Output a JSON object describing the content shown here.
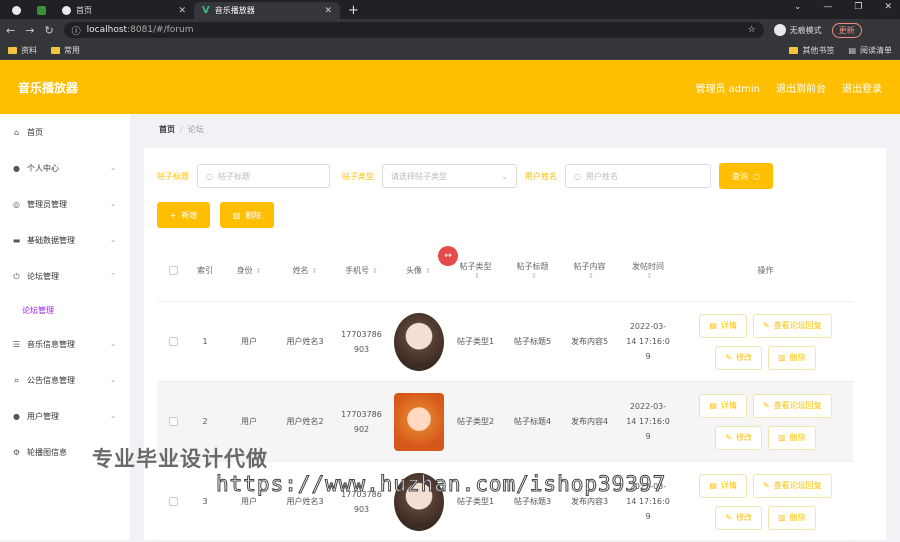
{
  "browser": {
    "tabs": [
      {
        "label": ""
      },
      {
        "label": ""
      },
      {
        "label": "首页"
      },
      {
        "label": "音乐播放器"
      }
    ],
    "url_host": "localhost",
    "url_path": ":8081/#/forum",
    "incognito_label": "无痕模式",
    "update_label": "更新",
    "bookmarks": [
      "资料",
      "常用"
    ],
    "bookmarks_right": [
      "其他书签",
      "阅读清单"
    ]
  },
  "header": {
    "brand": "音乐播放器",
    "admin": "管理员 admin",
    "back_to_front": "退出到前台",
    "logout": "退出登录"
  },
  "sidebar": {
    "items": [
      {
        "label": "首页",
        "icon": "home-icon"
      },
      {
        "label": "个人中心",
        "icon": "user-icon"
      },
      {
        "label": "管理员管理",
        "icon": "compass-icon"
      },
      {
        "label": "基础数据管理",
        "icon": "database-icon"
      },
      {
        "label": "论坛管理",
        "icon": "power-icon"
      },
      {
        "label": "音乐信息管理",
        "icon": "menu-icon"
      },
      {
        "label": "公告信息管理",
        "icon": "crop-icon"
      },
      {
        "label": "用户管理",
        "icon": "user-icon"
      },
      {
        "label": "轮播图信息",
        "icon": "settings-icon"
      }
    ],
    "subitem": "论坛管理"
  },
  "breadcrumb": {
    "home": "首页",
    "sep": "/",
    "current": "论坛"
  },
  "search": {
    "title_label": "帖子标题",
    "title_placeholder": "帖子标题",
    "type_label": "帖子类型",
    "type_placeholder": "请选择帖子类型",
    "user_label": "用户姓名",
    "user_placeholder": "用户姓名",
    "query_button": "查询"
  },
  "actions": {
    "add": "新增",
    "delete": "删除"
  },
  "table": {
    "headers": [
      "索引",
      "身份",
      "姓名",
      "手机号",
      "头像",
      "帖子类型",
      "帖子标题",
      "帖子内容",
      "发帖时间",
      "操作"
    ],
    "rows": [
      {
        "index": "1",
        "role": "用户",
        "name": "用户姓名3",
        "phone1": "17703786",
        "phone2": "903",
        "type": "帖子类型1",
        "title": "帖子标题5",
        "content": "发布内容5",
        "time1": "2022-03-",
        "time2": "14 17:16:0",
        "time3": "9"
      },
      {
        "index": "2",
        "role": "用户",
        "name": "用户姓名2",
        "phone1": "17703786",
        "phone2": "902",
        "type": "帖子类型2",
        "title": "帖子标题4",
        "content": "发布内容4",
        "time1": "2022-03-",
        "time2": "14 17:16:0",
        "time3": "9"
      },
      {
        "index": "3",
        "role": "用户",
        "name": "用户姓名3",
        "phone1": "17703786",
        "phone2": "903",
        "type": "帖子类型1",
        "title": "帖子标题3",
        "content": "发布内容3",
        "time1": "2022-03-",
        "time2": "14 17:16:0",
        "time3": "9"
      }
    ],
    "op_detail": "详情",
    "op_replies": "查看论坛回复",
    "op_edit": "修改",
    "op_delete": "删除"
  },
  "watermark": {
    "line1": "专业毕业设计代做",
    "line2": "https://www.huzhan.com/ishop39397"
  },
  "colors": {
    "accent": "#ffbf00",
    "submenu": "#a020f0"
  }
}
